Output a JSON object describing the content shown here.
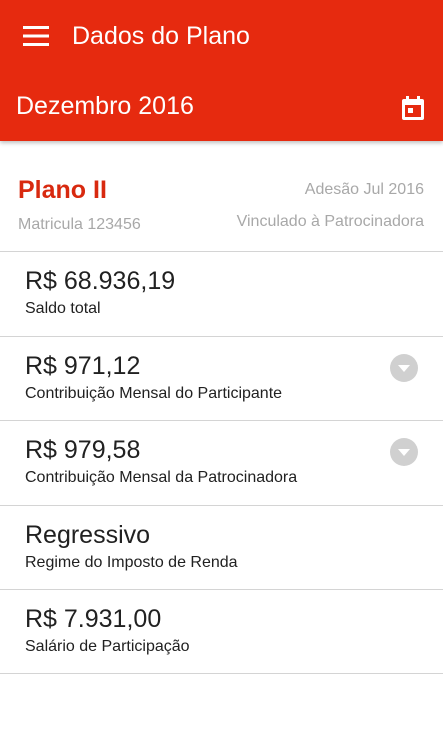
{
  "app_bar": {
    "title": "Dados do Plano",
    "menu_icon": "hamburger-menu-icon"
  },
  "period": {
    "label": "Dezembro 2016",
    "calendar_icon": "calendar-icon"
  },
  "plan": {
    "name": "Plano II",
    "enrollment": "Matricula 123456",
    "adhesion": "Adesão Jul 2016",
    "link": "Vinculado à Patrocinadora"
  },
  "items": [
    {
      "amount": "R$ 68.936,19",
      "caption": "Saldo total",
      "expandable": false
    },
    {
      "amount": "R$ 971,12",
      "caption": "Contribuição Mensal do Participante",
      "expandable": true
    },
    {
      "amount": "R$ 979,58",
      "caption": "Contribuição Mensal da Patrocinadora",
      "expandable": true
    },
    {
      "amount": "Regressivo",
      "caption": "Regime do Imposto de Renda",
      "expandable": false
    },
    {
      "amount": "R$ 7.931,00",
      "caption": "Salário de Participação",
      "expandable": false
    }
  ],
  "colors": {
    "primary": "#e62a0f",
    "plan_name": "#d8290f",
    "muted_text": "#a8a8a8",
    "divider": "#d4d4d4",
    "expand_icon": "#d0d0d0"
  }
}
